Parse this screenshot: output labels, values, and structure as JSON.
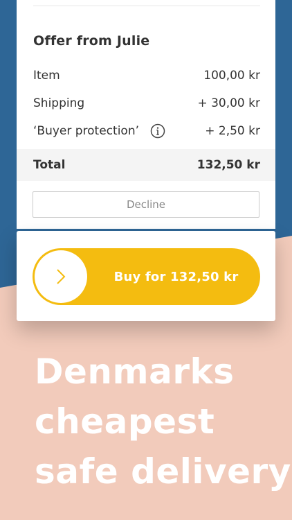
{
  "offer": {
    "title": "Offer from Julie",
    "lines": [
      {
        "label": "Item",
        "value": "100,00 kr"
      },
      {
        "label": "Shipping",
        "value": "+ 30,00 kr"
      },
      {
        "label": "‘Buyer protection’",
        "value": "+ 2,50 kr",
        "icon": "info-icon"
      }
    ],
    "total": {
      "label": "Total",
      "value": "132,50 kr"
    },
    "decline_label": "Decline"
  },
  "buy": {
    "label": "Buy for 132,50 kr",
    "knob_icon": "chevron-right-icon"
  },
  "promo": {
    "lines": [
      "Denmarks",
      "cheapest",
      "safe delivery"
    ]
  },
  "colors": {
    "accent": "#f4bc10",
    "background_top": "#2e6696",
    "background_bottom": "#f2cbbb"
  }
}
